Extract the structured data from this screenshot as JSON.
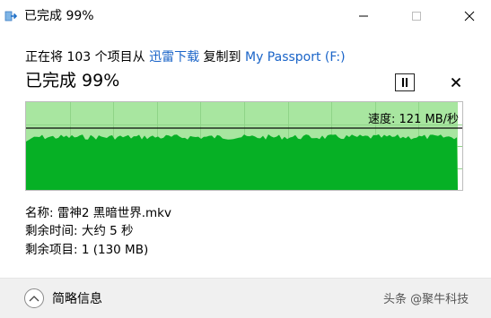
{
  "window": {
    "title": "已完成 99%",
    "minimize_icon": "minimize-icon",
    "maximize_icon": "maximize-icon",
    "close_icon": "close-icon"
  },
  "copy": {
    "prefix": "正在将 103 个项目从 ",
    "source": "迅雷下载",
    "middle": " 复制到 ",
    "destination": "My Passport (F:)"
  },
  "progress": {
    "status": "已完成 99%",
    "percent": 99
  },
  "speed": {
    "text": "速度: 121 MB/秒"
  },
  "details": {
    "name": "名称: 雷神2 黑暗世界.mkv",
    "time_remaining": "剩余时间: 大约 5 秒",
    "items_remaining": "剩余项目: 1 (130 MB)"
  },
  "footer": {
    "toggle_label": "简略信息"
  },
  "watermark": "头条 @聚牛科技",
  "colors": {
    "graph_fill": "#06b025",
    "graph_progress": "#a8e6a0",
    "link": "#1a64c8"
  }
}
